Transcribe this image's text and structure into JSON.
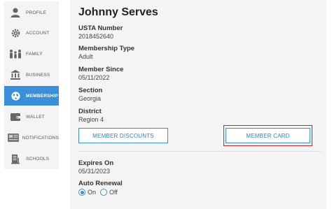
{
  "sidebar": {
    "items": [
      {
        "label": "PROFILE",
        "icon": "person-icon"
      },
      {
        "label": "ACCOUNT",
        "icon": "gear-icon"
      },
      {
        "label": "FAMILY",
        "icon": "family-icon"
      },
      {
        "label": "BUSINESS",
        "icon": "bank-icon"
      },
      {
        "label": "MEMBERSHIP",
        "icon": "globe-icon",
        "active": true
      },
      {
        "label": "WALLET",
        "icon": "wallet-icon"
      },
      {
        "label": "NOTIFICATIONS",
        "icon": "newspaper-icon"
      },
      {
        "label": "SCHOOLS",
        "icon": "school-icon"
      }
    ],
    "active_color": "#3b8fd9"
  },
  "member": {
    "name": "Johnny Serves",
    "fields": [
      {
        "label": "USTA Number",
        "value": "2018452640"
      },
      {
        "label": "Membership Type",
        "value": "Adult"
      },
      {
        "label": "Member Since",
        "value": "05/11/2022"
      },
      {
        "label": "Section",
        "value": "Georgia"
      },
      {
        "label": "District",
        "value": "Region 4"
      }
    ]
  },
  "buttons": {
    "discounts": "MEMBER DISCOUNTS",
    "card": "MEMBER CARD"
  },
  "expiry": {
    "label": "Expires On",
    "value": "05/31/2023"
  },
  "auto_renewal": {
    "label": "Auto Renewal",
    "on_label": "On",
    "off_label": "Off",
    "selected": "On"
  },
  "colors": {
    "accent": "#3b8fd9",
    "highlight_outline": "#d21f26"
  }
}
